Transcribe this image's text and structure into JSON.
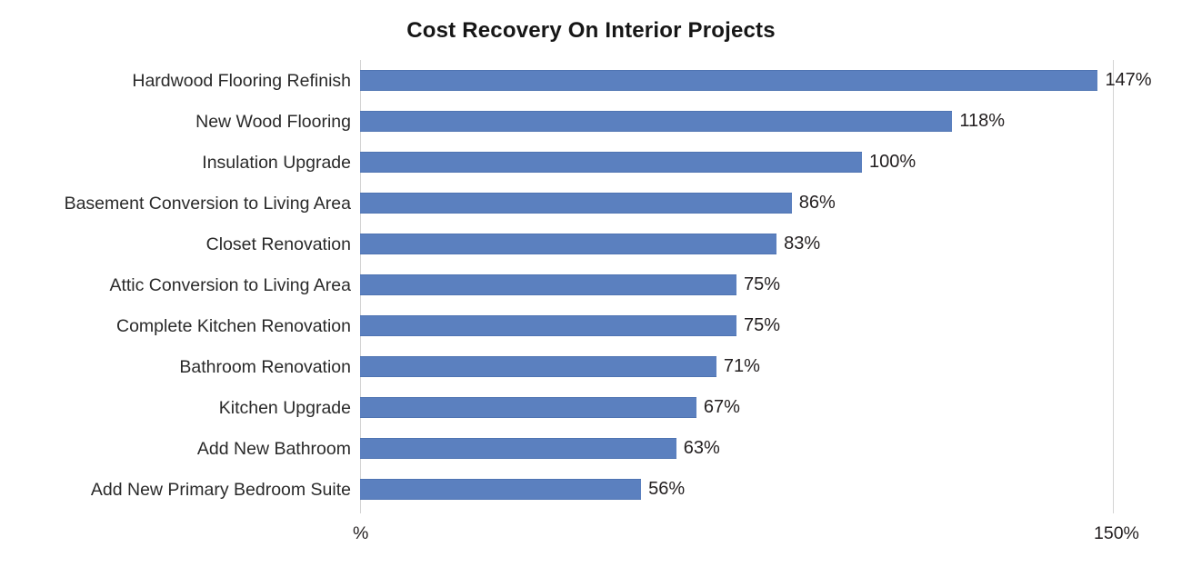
{
  "chart_data": {
    "type": "bar",
    "orientation": "horizontal",
    "title": "Cost Recovery On Interior Projects",
    "xlabel": "",
    "ylabel": "",
    "xlim": [
      0,
      150
    ],
    "grid": true,
    "gridlines": [
      0,
      150
    ],
    "legend": null,
    "bar_color": "#5b80bf",
    "value_label_suffix": "%",
    "axis_ticks": [
      {
        "value": 0,
        "label": "%"
      },
      {
        "value": 150,
        "label": "150%"
      }
    ],
    "categories": [
      "Hardwood Flooring Refinish",
      "New Wood Flooring",
      "Insulation Upgrade",
      "Basement Conversion to Living Area",
      "Closet Renovation",
      "Attic Conversion to Living Area",
      "Complete Kitchen Renovation",
      "Bathroom Renovation",
      "Kitchen Upgrade",
      "Add New Bathroom",
      "Add New Primary Bedroom Suite"
    ],
    "values": [
      147,
      118,
      100,
      86,
      83,
      75,
      75,
      71,
      67,
      63,
      56
    ],
    "value_labels": [
      "147%",
      "118%",
      "100%",
      "86%",
      "83%",
      "75%",
      "75%",
      "71%",
      "67%",
      "63%",
      "56%"
    ]
  }
}
